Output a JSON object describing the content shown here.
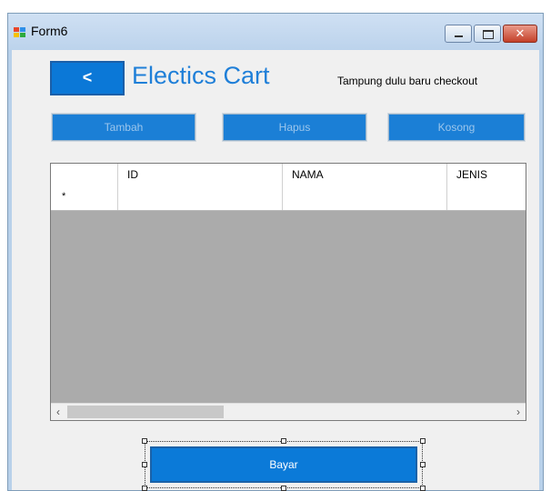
{
  "window": {
    "title": "Form6",
    "icon": "winforms-form-icon",
    "controls": [
      "minimize-icon",
      "maximize-icon",
      "close-icon"
    ]
  },
  "form": {
    "back_label": "<",
    "heading": "Electics Cart",
    "note": "Tampung dulu baru checkout",
    "buttons": {
      "tambah": "Tambah",
      "hapus": "Hapus",
      "kosong": "Kosong"
    },
    "grid": {
      "columns": [
        "ID",
        "NAMA",
        "JENIS"
      ],
      "new_row_marker": "*"
    },
    "bayar_label": "Bayar"
  },
  "colors": {
    "accent": "#0b78d7",
    "title_blue": "#1f7fd8",
    "grid_background": "#ababab"
  }
}
